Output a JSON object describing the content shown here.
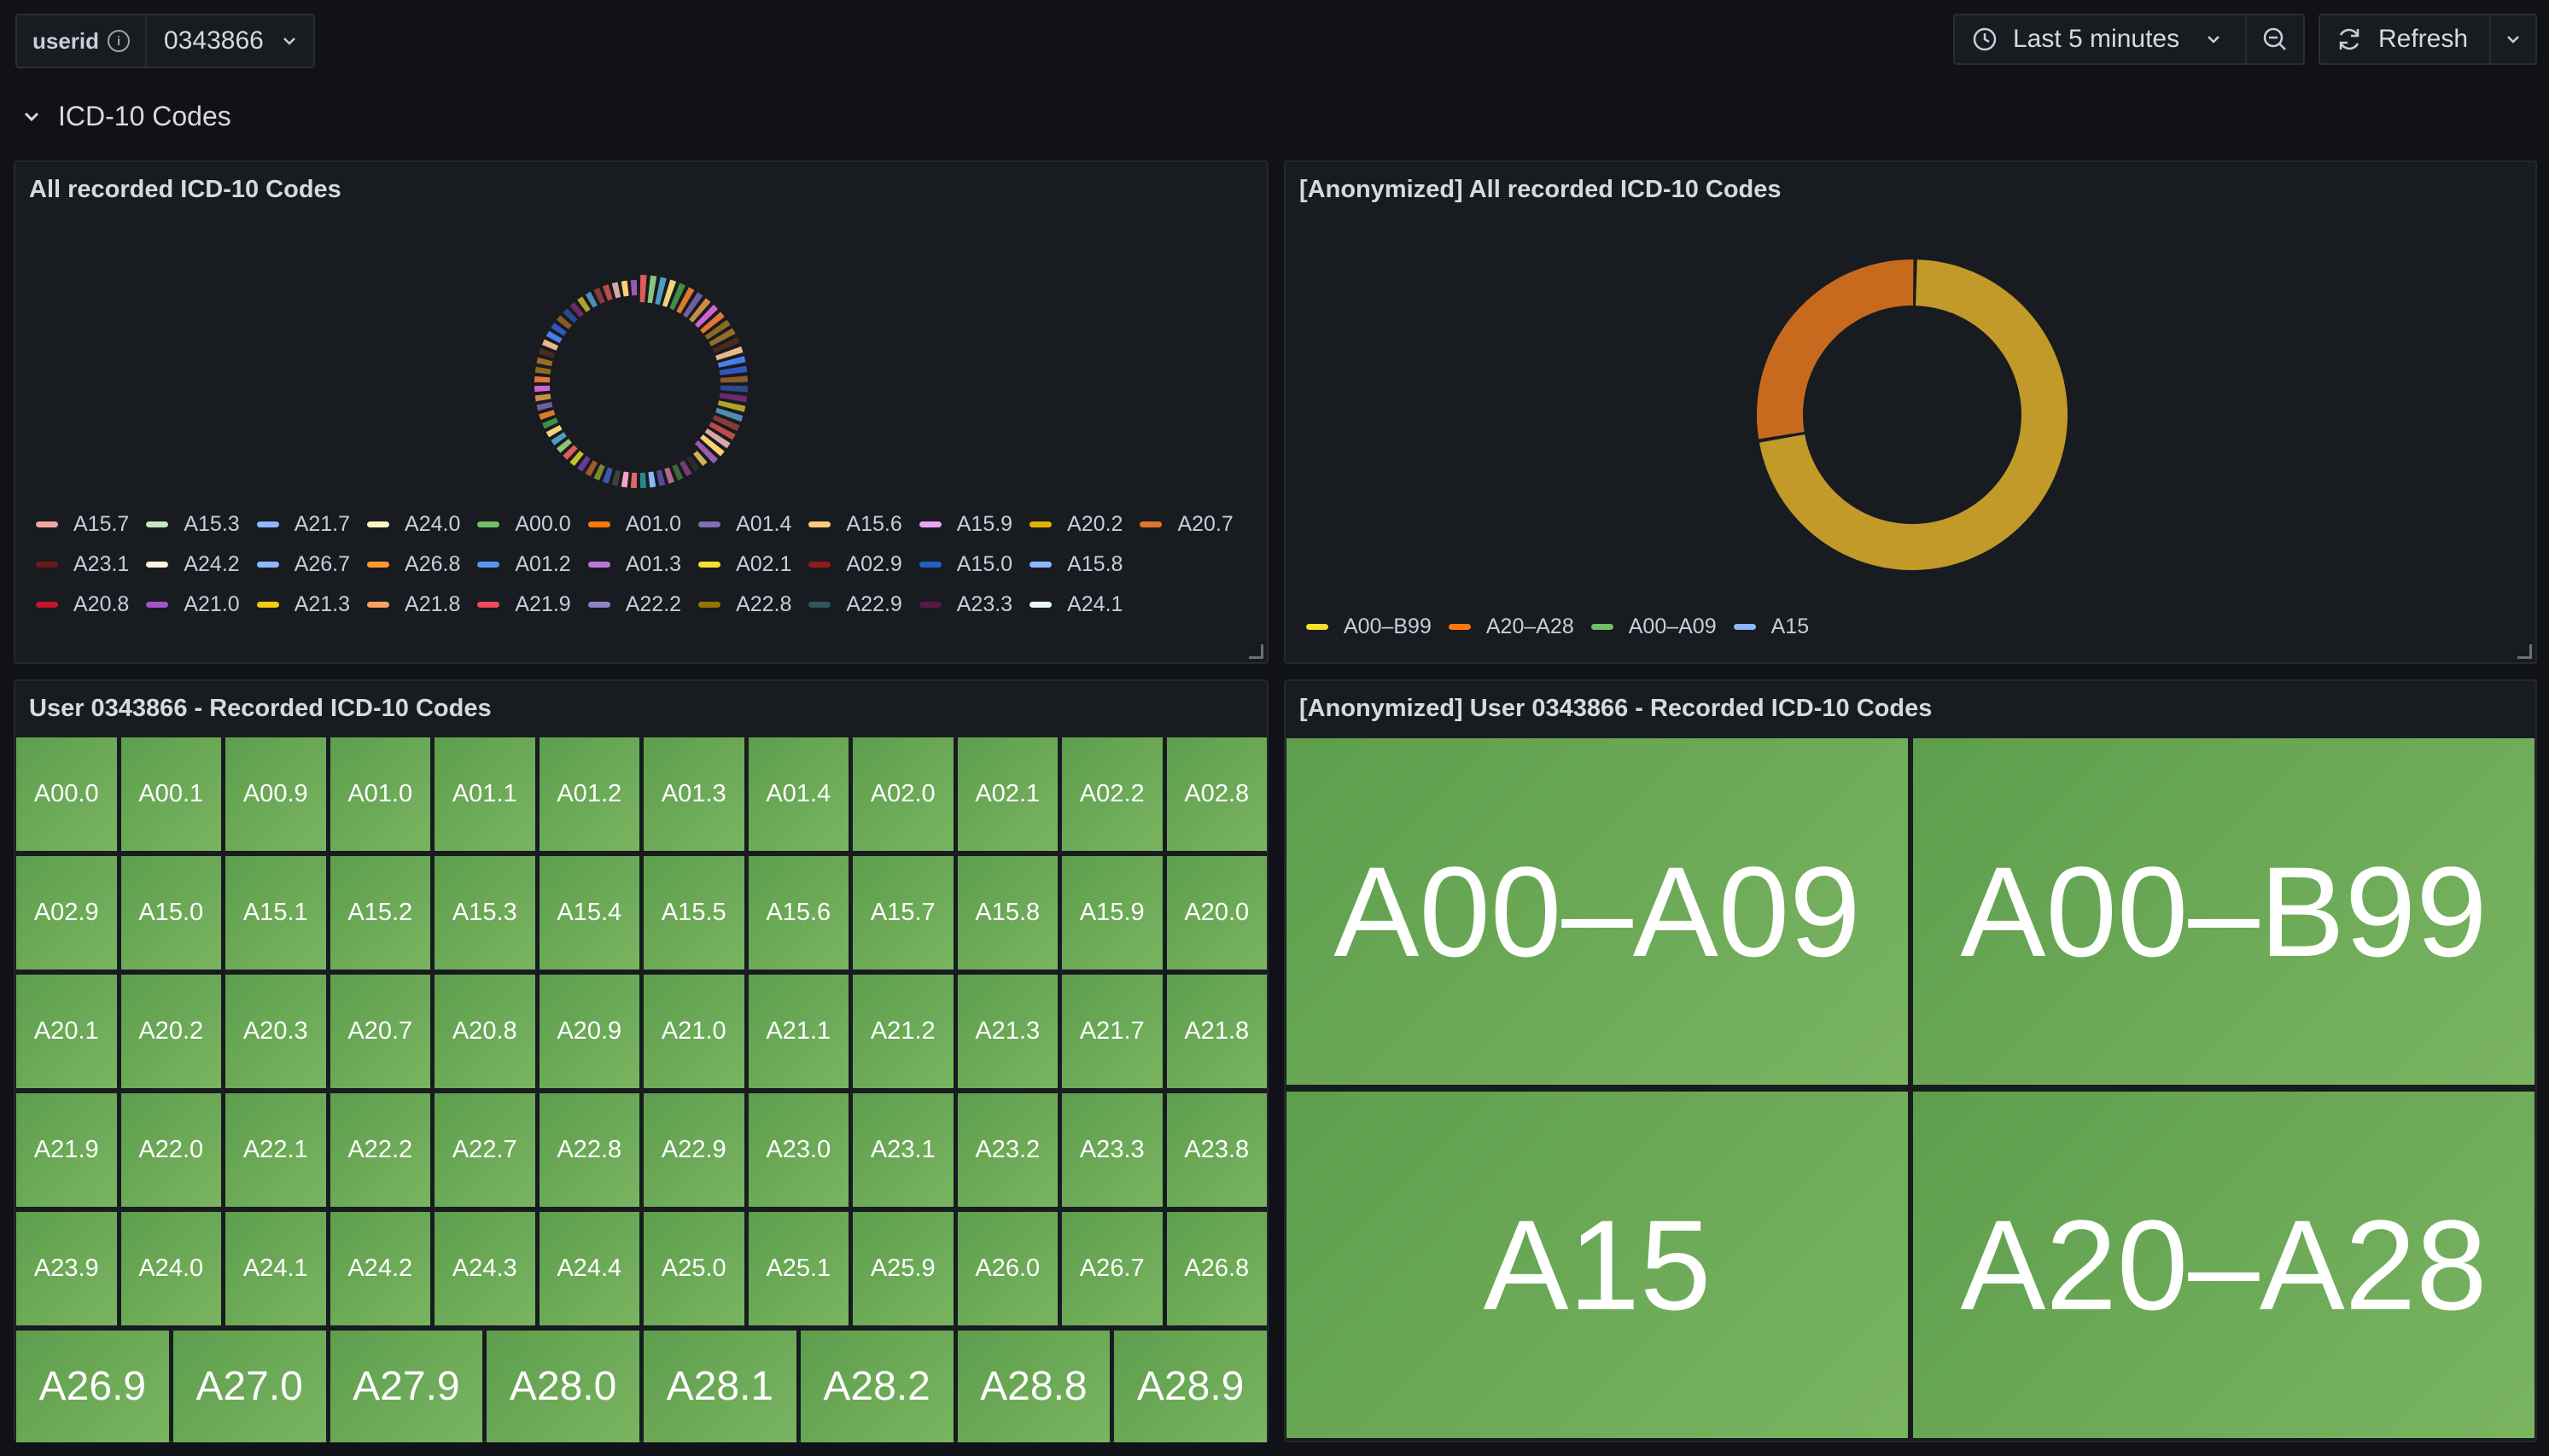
{
  "topbar": {
    "variable_label": "userid",
    "variable_value": "0343866",
    "time_range": "Last 5 minutes",
    "refresh_label": "Refresh"
  },
  "section": {
    "title": "ICD-10 Codes"
  },
  "panels": {
    "all_codes": {
      "title": "All recorded ICD-10 Codes",
      "legend": [
        [
          "A15.7",
          "#f2a5a5"
        ],
        [
          "A15.3",
          "#c8e6c0"
        ],
        [
          "A21.7",
          "#8ab8ff"
        ],
        [
          "A24.0",
          "#fff4c2"
        ],
        [
          "A00.0",
          "#73bf69"
        ],
        [
          "A01.0",
          "#ff780a"
        ],
        [
          "A01.4",
          "#806eb7"
        ],
        [
          "A15.6",
          "#ffcb7d"
        ],
        [
          "A15.9",
          "#e8a5f2"
        ],
        [
          "A20.2",
          "#e0b400"
        ],
        [
          "A20.7",
          "#e0752d"
        ],
        [
          "A23.1",
          "#6b1a1a"
        ],
        [
          "A24.2",
          "#fff0dc"
        ],
        [
          "A26.7",
          "#8ab8ff"
        ],
        [
          "A26.8",
          "#ff9830"
        ],
        [
          "A01.2",
          "#5794f2"
        ],
        [
          "A01.3",
          "#b877d9"
        ],
        [
          "A02.1",
          "#fade2a"
        ],
        [
          "A02.9",
          "#8f1b1b"
        ],
        [
          "A15.0",
          "#1f60c4"
        ],
        [
          "A15.8",
          "#8ab8ff"
        ],
        [
          "A20.8",
          "#c4162a"
        ],
        [
          "A21.0",
          "#a352cc"
        ],
        [
          "A21.3",
          "#f2cc0c"
        ],
        [
          "A21.8",
          "#ff9e62"
        ],
        [
          "A21.9",
          "#f2495c"
        ],
        [
          "A22.2",
          "#8f82c9"
        ],
        [
          "A22.8",
          "#967302"
        ],
        [
          "A22.9",
          "#2f575e"
        ],
        [
          "A23.3",
          "#581845"
        ],
        [
          "A24.1",
          "#e8f7ff"
        ]
      ]
    },
    "anon_codes": {
      "title": "[Anonymized] All recorded ICD-10 Codes",
      "legend": [
        [
          "A00–B99",
          "#fade2a"
        ],
        [
          "A20–A28",
          "#ff780a"
        ],
        [
          "A00–A09",
          "#73bf69"
        ],
        [
          "A15",
          "#8ab8ff"
        ]
      ]
    },
    "user_codes": {
      "title": "User 0343866 - Recorded ICD-10 Codes",
      "codes": [
        "A00.0",
        "A00.1",
        "A00.9",
        "A01.0",
        "A01.1",
        "A01.2",
        "A01.3",
        "A01.4",
        "A02.0",
        "A02.1",
        "A02.2",
        "A02.8",
        "A02.9",
        "A15.0",
        "A15.1",
        "A15.2",
        "A15.3",
        "A15.4",
        "A15.5",
        "A15.6",
        "A15.7",
        "A15.8",
        "A15.9",
        "A20.0",
        "A20.1",
        "A20.2",
        "A20.3",
        "A20.7",
        "A20.8",
        "A20.9",
        "A21.0",
        "A21.1",
        "A21.2",
        "A21.3",
        "A21.7",
        "A21.8",
        "A21.9",
        "A22.0",
        "A22.1",
        "A22.2",
        "A22.7",
        "A22.8",
        "A22.9",
        "A23.0",
        "A23.1",
        "A23.2",
        "A23.3",
        "A23.8",
        "A23.9",
        "A24.0",
        "A24.1",
        "A24.2",
        "A24.3",
        "A24.4",
        "A25.0",
        "A25.1",
        "A25.9",
        "A26.0",
        "A26.7",
        "A26.8"
      ],
      "last_row": [
        "A26.9",
        "A27.0",
        "A27.9",
        "A28.0",
        "A28.1",
        "A28.2",
        "A28.8",
        "A28.9"
      ]
    },
    "anon_user_codes": {
      "title": "[Anonymized] User 0343866 - Recorded ICD-10 Codes",
      "codes": [
        "A00–A09",
        "A00–B99",
        "A15",
        "A20–A28"
      ]
    }
  },
  "chart_data": [
    {
      "type": "pie",
      "title": "All recorded ICD-10 Codes",
      "series": [
        {
          "values": [
            1,
            1,
            1,
            1,
            1,
            1,
            1,
            1,
            1,
            1,
            1,
            1,
            1,
            1,
            1,
            1,
            1,
            1,
            1,
            1,
            1,
            1,
            1,
            1,
            1,
            1,
            1,
            1,
            1,
            1,
            1,
            1,
            1,
            1,
            1,
            1,
            1,
            1,
            1,
            1,
            1,
            1,
            1,
            1,
            1,
            1,
            1,
            1,
            1,
            1,
            1,
            1,
            1,
            1,
            1,
            1,
            1,
            1,
            1,
            1,
            1,
            1,
            1,
            1,
            1,
            1,
            1,
            1
          ]
        }
      ],
      "note_colors": [
        "#e05a5a",
        "#8fc37a",
        "#4e9dbf",
        "#f2d27a",
        "#3f8f47",
        "#d97b2b",
        "#6f5f9e",
        "#c98e45",
        "#d163d1",
        "#e5733b",
        "#8a6a1e",
        "#9a6a2a",
        "#4a2a1e",
        "#e8b88a",
        "#4a7ee8",
        "#3257c2",
        "#8a5a2a",
        "#2d4a8f",
        "#6b2a6b",
        "#b0a22a",
        "#4a8fb0",
        "#8a3a3a",
        "#c04a4a",
        "#d8a8a8",
        "#ffd070",
        "#9a5ab0",
        "#d0b060",
        "#2a2a2a",
        "#7a3a7a",
        "#3a6a3a",
        "#b06a8a",
        "#5a4a9a",
        "#8ab8ff",
        "#2a8a8a",
        "#d86a6a",
        "#f2a5c0",
        "#404040",
        "#3a5ab0",
        "#7a8a2a",
        "#a05a30",
        "#6a3a9a",
        "#c7c020"
      ]
    },
    {
      "type": "pie",
      "title": "[Anonymized] All recorded ICD-10 Codes",
      "categories": [
        "A00–B99",
        "A20–A28"
      ],
      "values": [
        72,
        28
      ]
    }
  ]
}
